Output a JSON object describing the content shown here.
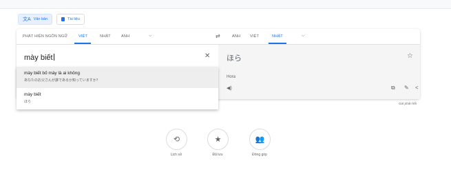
{
  "modes": [
    {
      "label": "Văn bản",
      "icon": "translate-icon",
      "active": true
    },
    {
      "label": "Tài liệu",
      "icon": "document-icon",
      "active": false
    }
  ],
  "source_langs": [
    "PHÁT HIỆN NGÔN NGỮ",
    "VIỆT",
    "NHẬT",
    "ANH"
  ],
  "source_active": "VIỆT",
  "target_langs": [
    "ANH",
    "VIỆT",
    "NHẬT"
  ],
  "target_active": "NHẬT",
  "source": {
    "text": "mày biết"
  },
  "target": {
    "text": "ほら",
    "romanization": "Hora"
  },
  "suggestions": [
    {
      "main": "mày biết bố mày là ai không",
      "sub": "あなたのお父さんが誰であるか知っていますか？"
    },
    {
      "main": "mày biết",
      "sub": "ほら"
    }
  ],
  "feedback": "Gửi phản hồi",
  "bottom": [
    {
      "label": "Lịch sử",
      "icon": "history-icon"
    },
    {
      "label": "Đã lưu",
      "icon": "star-icon"
    },
    {
      "label": "Đóng góp",
      "icon": "contribute-icon"
    }
  ]
}
